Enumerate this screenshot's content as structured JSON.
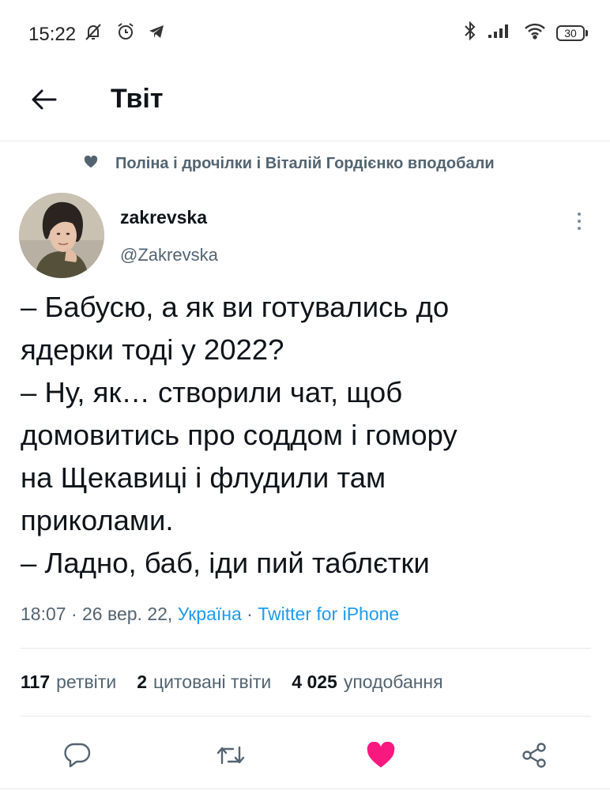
{
  "status_bar": {
    "time": "15:22",
    "battery": "30",
    "icons": [
      "muted-bell-icon",
      "alarm-clock-icon",
      "telegram-icon",
      "bluetooth-icon",
      "signal-icon",
      "wifi-icon",
      "battery-icon"
    ]
  },
  "header": {
    "title": "Твіт",
    "back_icon": "back-arrow-icon"
  },
  "tweet": {
    "social_context": "Поліна і дрочілки і Віталій Гордієнко вподобали",
    "author": {
      "display_name": "zakrevska",
      "handle": "@Zakrevska"
    },
    "text_lines": [
      "– Бабусю, а як ви готувались до",
      "ядерки тоді у 2022?",
      "– Ну, як… створили чат, щоб",
      "домовитись про соддом і гомору",
      "на Щекавиці і флудили там",
      "приколами.",
      "– Ладно, баб, іди пий таблєтки"
    ],
    "meta": {
      "time": "18:07",
      "separator1": " · ",
      "date": "26 вер. 22,",
      "location": "Україна",
      "separator2": " · ",
      "source": "Twitter for iPhone"
    },
    "stats": {
      "retweets_count": "117",
      "retweets_label": "ретвіти",
      "quotes_count": "2",
      "quotes_label": "цитовані твіти",
      "likes_count": "4 025",
      "likes_label": "уподобання"
    },
    "actions": [
      "reply-icon",
      "retweet-icon",
      "like-icon",
      "share-icon"
    ]
  },
  "colors": {
    "text_primary": "#0f1419",
    "text_secondary": "#536471",
    "link": "#1d9bf0",
    "like_active": "#f91880",
    "divider": "#e5e8eb"
  }
}
